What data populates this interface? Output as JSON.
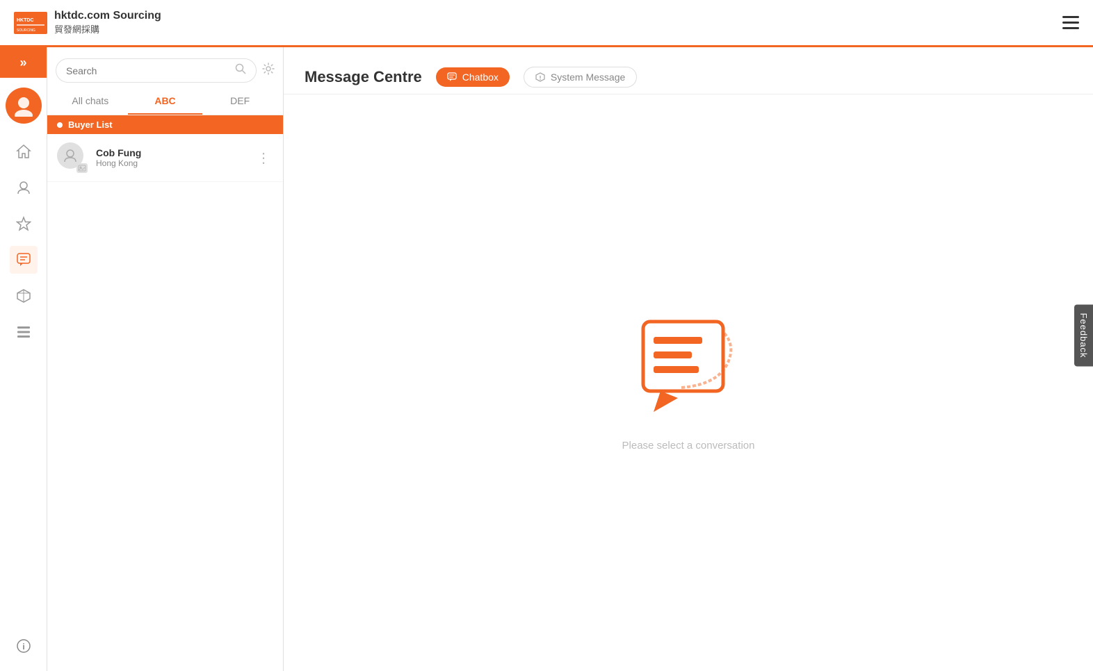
{
  "header": {
    "logo_alt": "HKTDC",
    "site_name": "hktdc.com Sourcing",
    "site_name_zh": "貿發網採購"
  },
  "page": {
    "title": "Message Centre",
    "tabs": [
      {
        "id": "chatbox",
        "label": "Chatbox",
        "active": true
      },
      {
        "id": "system-message",
        "label": "System Message",
        "active": false
      }
    ]
  },
  "chat_panel": {
    "search_placeholder": "Search",
    "tabs": [
      {
        "id": "all-chats",
        "label": "All chats",
        "active": false
      },
      {
        "id": "abc",
        "label": "ABC",
        "active": true
      },
      {
        "id": "def",
        "label": "DEF",
        "active": false
      }
    ],
    "buyer_list_label": "Buyer List",
    "contacts": [
      {
        "name": "Cob Fung",
        "location": "Hong Kong"
      }
    ]
  },
  "empty_state": {
    "message": "Please select a conversation"
  },
  "sidebar": {
    "toggle_icon": "»",
    "items": [
      {
        "id": "home",
        "icon": "⌂",
        "active": false
      },
      {
        "id": "user",
        "icon": "👤",
        "active": false
      },
      {
        "id": "star",
        "icon": "★",
        "active": false
      },
      {
        "id": "chat",
        "icon": "💬",
        "active": true
      },
      {
        "id": "box",
        "icon": "⬡",
        "active": false
      },
      {
        "id": "list",
        "icon": "☰",
        "active": false
      }
    ],
    "bottom_icon": "ℹ"
  },
  "feedback": {
    "label": "Feedback"
  }
}
